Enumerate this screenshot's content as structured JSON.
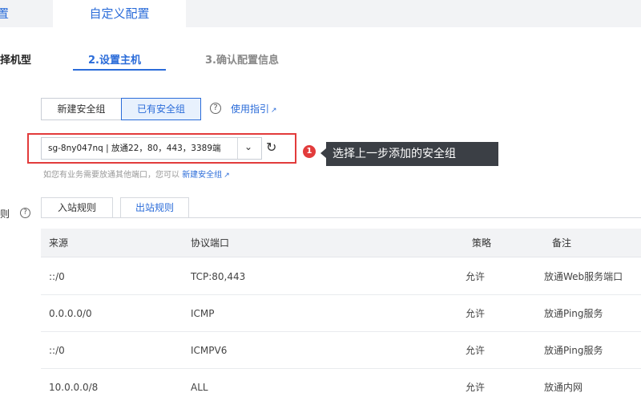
{
  "top_tabs": {
    "left_partial": "置",
    "active": "自定义配置"
  },
  "steps": [
    {
      "label": "择机型"
    },
    {
      "label": "2.设置主机"
    },
    {
      "label": "3.确认配置信息"
    }
  ],
  "security_group": {
    "new_button": "新建安全组",
    "existing_button": "已有安全组",
    "help_icon": "question-circle-icon",
    "guide_link": "使用指引",
    "select_value": "sg-8ny047nq | 放通22，80，443，3389端",
    "hint_text": "如您有业务需要放通其他端口，您可以",
    "hint_link": "新建安全组"
  },
  "annotation": {
    "number": "1",
    "text": "选择上一步添加的安全组",
    "color": "#e23b3b"
  },
  "rules": {
    "label": "则",
    "tabs": [
      "入站规则",
      "出站规则"
    ],
    "columns": [
      "来源",
      "协议端口",
      "策略",
      "备注"
    ],
    "rows": [
      {
        "source": "::/0",
        "port": "TCP:80,443",
        "policy": "允许",
        "note": "放通Web服务端口"
      },
      {
        "source": "0.0.0.0/0",
        "port": "ICMP",
        "policy": "允许",
        "note": "放通Ping服务"
      },
      {
        "source": "::/0",
        "port": "ICMPV6",
        "policy": "允许",
        "note": "放通Ping服务"
      },
      {
        "source": "10.0.0.0/8",
        "port": "ALL",
        "policy": "允许",
        "note": "放通内网"
      }
    ]
  },
  "colors": {
    "accent": "#2b6cd9",
    "highlight": "#e23b3b",
    "tooltip_bg": "#3b3f45"
  }
}
